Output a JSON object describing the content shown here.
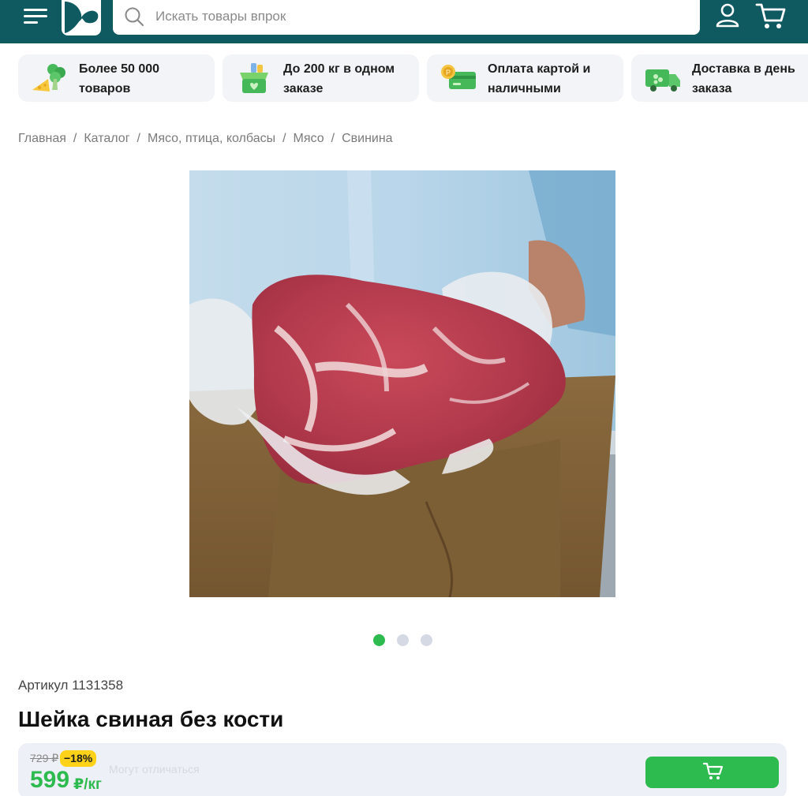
{
  "header": {
    "search_placeholder": "Искать товары впрок",
    "colors": {
      "header_bg": "#0f5a60",
      "accent_green": "#2dba4e"
    },
    "icons": [
      "menu-icon",
      "logo-icon",
      "search-icon",
      "user-icon",
      "cart-icon"
    ]
  },
  "features": [
    {
      "icon": "broccoli-cheese-icon",
      "text": "Более 50 000 товаров"
    },
    {
      "icon": "grocery-box-icon",
      "text": "До 200 кг в одном заказе"
    },
    {
      "icon": "card-coin-icon",
      "text": "Оплата картой и наличными"
    },
    {
      "icon": "delivery-truck-icon",
      "text": "Доставка в день заказа"
    }
  ],
  "breadcrumb": {
    "items": [
      "Главная",
      "Каталог",
      "Мясо, птица, колбасы",
      "Мясо",
      "Свинина"
    ],
    "separator": "/"
  },
  "gallery": {
    "slides": 3,
    "active_slide": 1
  },
  "product": {
    "article": "Артикул 1131358",
    "title": "Шейка свиная без кости",
    "old_price": "729 ₽",
    "discount": "−18%",
    "price": "599",
    "unit": "₽/кг",
    "faded_note": "Могут отличаться"
  }
}
